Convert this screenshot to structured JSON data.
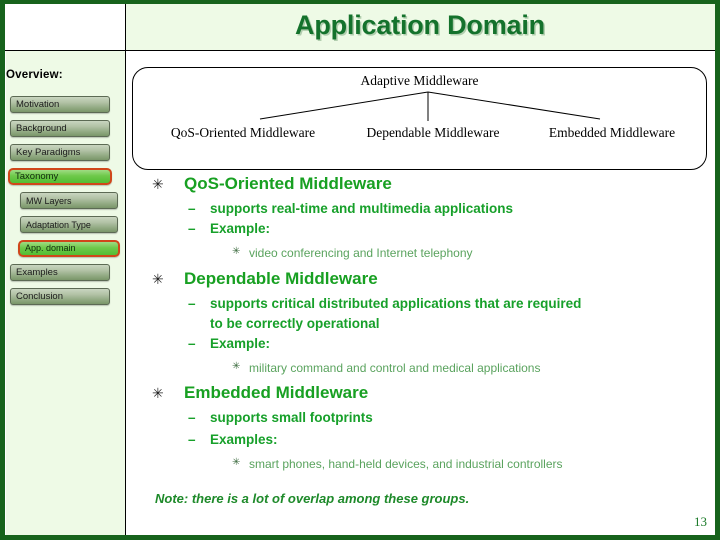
{
  "slide": {
    "title": "Application Domain",
    "page_number": "13",
    "accent_green": "#14722c",
    "body_green": "#18a022",
    "frame_green": "#17631c",
    "sidebar_bg": "#eefae6",
    "highlight_border": "#d0471a",
    "highlight_fill": "#53bd33"
  },
  "sidebar": {
    "heading": "Overview:",
    "items": [
      {
        "label": "Motivation",
        "level": 1,
        "highlighted": false
      },
      {
        "label": "Background",
        "level": 1,
        "highlighted": false
      },
      {
        "label": "Key Paradigms",
        "level": 1,
        "highlighted": false
      },
      {
        "label": "Taxonomy",
        "level": 1,
        "highlighted": true
      },
      {
        "label": "MW Layers",
        "level": 2,
        "highlighted": false
      },
      {
        "label": "Adaptation Type",
        "level": 2,
        "highlighted": false
      },
      {
        "label": "App. domain",
        "level": 2,
        "highlighted": true
      },
      {
        "label": "Examples",
        "level": 1,
        "highlighted": false
      },
      {
        "label": "Conclusion",
        "level": 1,
        "highlighted": false
      }
    ]
  },
  "diagram": {
    "root": "Adaptive Middleware",
    "leaves": [
      "QoS-Oriented Middleware",
      "Dependable Middleware",
      "Embedded Middleware"
    ]
  },
  "content": {
    "sections": [
      {
        "heading": "QoS-Oriented Middleware",
        "bullets": [
          "supports real-time and multimedia applications",
          "Example:"
        ],
        "subbullets": [
          "video conferencing and Internet telephony"
        ]
      },
      {
        "heading": "Dependable Middleware",
        "bullets": [
          "supports critical distributed applications that are required",
          "to be correctly operational",
          "Example:"
        ],
        "subbullets": [
          "military command and control and medical applications"
        ]
      },
      {
        "heading": "Embedded Middleware",
        "bullets": [
          "supports small footprints",
          "Examples:"
        ],
        "subbullets": [
          "smart phones, hand-held devices, and industrial controllers"
        ]
      }
    ],
    "dash": "–",
    "bullet_level1": "✳",
    "bullet_level3": "✳",
    "note": "Note: there is a lot of overlap among these groups."
  }
}
